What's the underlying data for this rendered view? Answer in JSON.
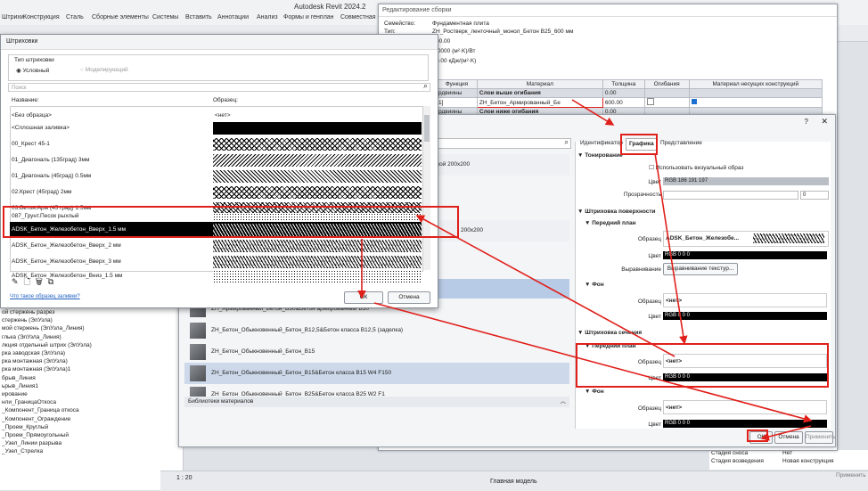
{
  "app": {
    "title": "Autodesk Revit 2024.2",
    "menu": [
      "Штрихи",
      "Конструкция",
      "Сталь",
      "Сборные элементы",
      "Системы",
      "Вставить",
      "Аннотации",
      "Анализ",
      "Формы и генплан",
      "Совместная р"
    ]
  },
  "left_panel": {
    "items": [
      "ой стержень разрез",
      "стержень (ЭлУзла)",
      "мой стержень (ЭлУзла_Линия)",
      "глька (ЭлУзла_Линия)",
      "лкция отдельный штрих (ЭлУзла)",
      "рка заводская (ЭлУзла)",
      "рка монтажная (ЭлУзла)",
      "рка монтажная (ЭлУзла)1",
      "брыв_Линия",
      "ьрыв_Линия1",
      "ирование",
      "нли_ГраницаОткоса",
      "_Компонент_Граница откоса",
      "_Компонент_Ограждение",
      "_Проем_Круглый",
      "_Проем_Прямоугольный",
      "_Узел_Линии разрыва",
      "_Узел_Стрелка"
    ],
    "scale": "1 : 20",
    "model": "Главная модель"
  },
  "assembly": {
    "title": "Редактирование сборки",
    "family_label": "Семейство:",
    "family_value": "Фундаментная плита",
    "type_label": "Тип:",
    "type_value": "ZH_Ростверк_ленточный_монол_Бетон В25_600 мм",
    "extra": [
      "00.00",
      ",0000 (м²·K)/Вт",
      "0.00 кДж/(м²·K)"
    ],
    "columns": [
      "Функция",
      "Материал",
      "Толщина",
      "Огибания",
      "Материал несущих конструкций"
    ],
    "rows": [
      {
        "func": "рдвиины",
        "mat": "Слои выше огибания",
        "thick": "0.00"
      },
      {
        "func": "1]",
        "mat": "ZH_Бетон_Армированный_Бе",
        "thick": "600.00"
      },
      {
        "func": "рдвиины",
        "mat": "Слои ниже огибания",
        "thick": "0.00"
      }
    ]
  },
  "materials": {
    "tabs": [
      "Идентификатор",
      "Графика",
      "Представление"
    ],
    "list": [
      "с ячейкой 200х200",
      "ZH_Армированный_Бетон_В30&Бетон армированный В30",
      "ZH_Бетон_Обыкновенный_Бетон_В12,5&Бетон класса В12,5 (заделка)",
      "ZH_Бетон_Обыкновенный_Бетон_В15",
      "ZH_Бетон_Обыкновенный_Бетон_В15&Бетон класса В15 W4 F150",
      "ZH_Бетон_Обыкновенный_Бетон_В25&Бетон класса В25 W2 F1"
    ],
    "list_extra": "200х200",
    "library_label": "Библиотеки материалов",
    "graphics": {
      "shading": "Тонирование",
      "use_render": "Использовать визуальный образ",
      "color_label": "Цвет",
      "shading_color": "RGB 186 191 197",
      "transparency_label": "Прозрачность",
      "transparency_value": "0",
      "surface": "Штриховка поверхности",
      "foreground": "Передний план",
      "background": "Фон",
      "pattern_label": "Образец",
      "surface_fg_pattern": "ADSK_Бетон_Железобе...",
      "rgb000": "RGB 0 0 0",
      "align_label": "Выравнивание",
      "align_btn": "Выравнивание текстур...",
      "none": "<нет>",
      "cut": "Штриховка сечения"
    },
    "ok": "ОК",
    "cancel": "Отмена",
    "apply": "Применить"
  },
  "hatch": {
    "title": "Штриховки",
    "type_label": "Тип штриховки",
    "type_conditional": "Условный",
    "type_model": "Моделирующий",
    "search_placeholder": "Поиск",
    "col_name": "Название:",
    "col_preview": "Образец:",
    "rows": [
      {
        "name": "<Без образца>",
        "preview": "<нет>"
      },
      {
        "name": "<Сплошная заливка>"
      },
      {
        "name": "00_Крест 45-1"
      },
      {
        "name": "01_Диагональ (135град) 3мм"
      },
      {
        "name": "01_Диагональ (45град) 0.5мм"
      },
      {
        "name": "02.Крест (45град) 2мм"
      },
      {
        "name": "03.Бетон.Арм (45 град) 1.5мм"
      },
      {
        "name": "087_Грунт.Песок рыхлый"
      },
      {
        "name": "ADSK_Бетон_Железобетон_Вверх_1.5 мм"
      },
      {
        "name": "ADSK_Бетон_Железобетон_Вверх_2 мм"
      },
      {
        "name": "ADSK_Бетон_Железобетон_Вверх_3 мм"
      },
      {
        "name": "ADSK_Бетон_Железобетон_Вниз_1.5 мм"
      }
    ],
    "help_link": "Что такое образец заливки?",
    "ok": "ОК",
    "cancel": "Отмена"
  },
  "props": {
    "rows": [
      "Стадия сноса",
      "Стадия возведения"
    ],
    "values": [
      "Нет",
      "Новая конструкция"
    ],
    "apply": "Применить"
  }
}
